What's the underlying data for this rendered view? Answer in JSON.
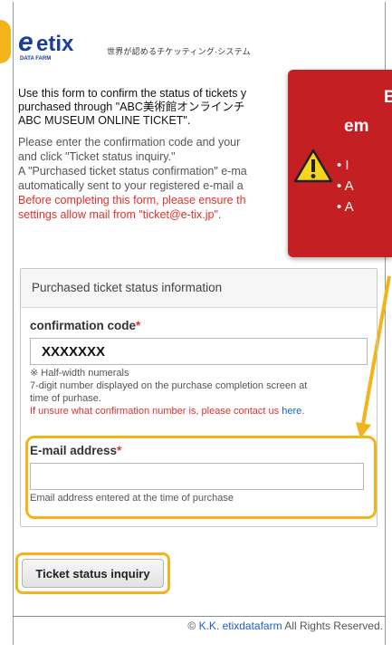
{
  "header": {
    "logo_text": "etix",
    "logo_subtext": "DATA FARM",
    "tagline": "世界が認めるチケッティング·システム"
  },
  "intro": {
    "line1": "Use this form to confirm the status of tickets y",
    "line2": "purchased through \"ABC美術館オンラインチ",
    "line3": "ABC MUSEUM ONLINE TICKET\"."
  },
  "instructions": {
    "line1": "Please enter the confirmation code and your",
    "line2": "and click \"Ticket status inquiry.\"",
    "line3": "A \"Purchased ticket status confirmation\" e-ma",
    "line4": "automatically sent to your registered e-mail a",
    "warn1": "Before completing this form, please ensure th",
    "warn2": "settings allow mail from \"ticket@e-tix.jp\"."
  },
  "callout": {
    "title1": "B",
    "title2": "em",
    "bullets": [
      "I",
      "A",
      "A"
    ]
  },
  "panel": {
    "heading": "Purchased ticket status information",
    "code_label": "confirmation code",
    "required_mark": "*",
    "code_value": "XXXXXXX",
    "code_help1": "※ Half-width numerals",
    "code_help2": "7-digit number displayed on the purchase completion screen at",
    "code_help3": "time of purhase.",
    "code_help4_prefix": "If unsure what confirmation number is, please contact us ",
    "code_help4_link": "here",
    "code_help4_suffix": ".",
    "email_label": "E-mail address",
    "email_value": "",
    "email_help": "Email address entered at the time of purchase"
  },
  "actions": {
    "submit_label": "Ticket status inquiry"
  },
  "footer": {
    "prefix": "© ",
    "company": "K.K. etixdatafarm",
    "suffix": " All Rights Reserved."
  },
  "colors": {
    "highlight": "#f2b31b",
    "callout_bg": "#c41f22",
    "required": "#e0312b",
    "link": "#1a5fc7"
  }
}
